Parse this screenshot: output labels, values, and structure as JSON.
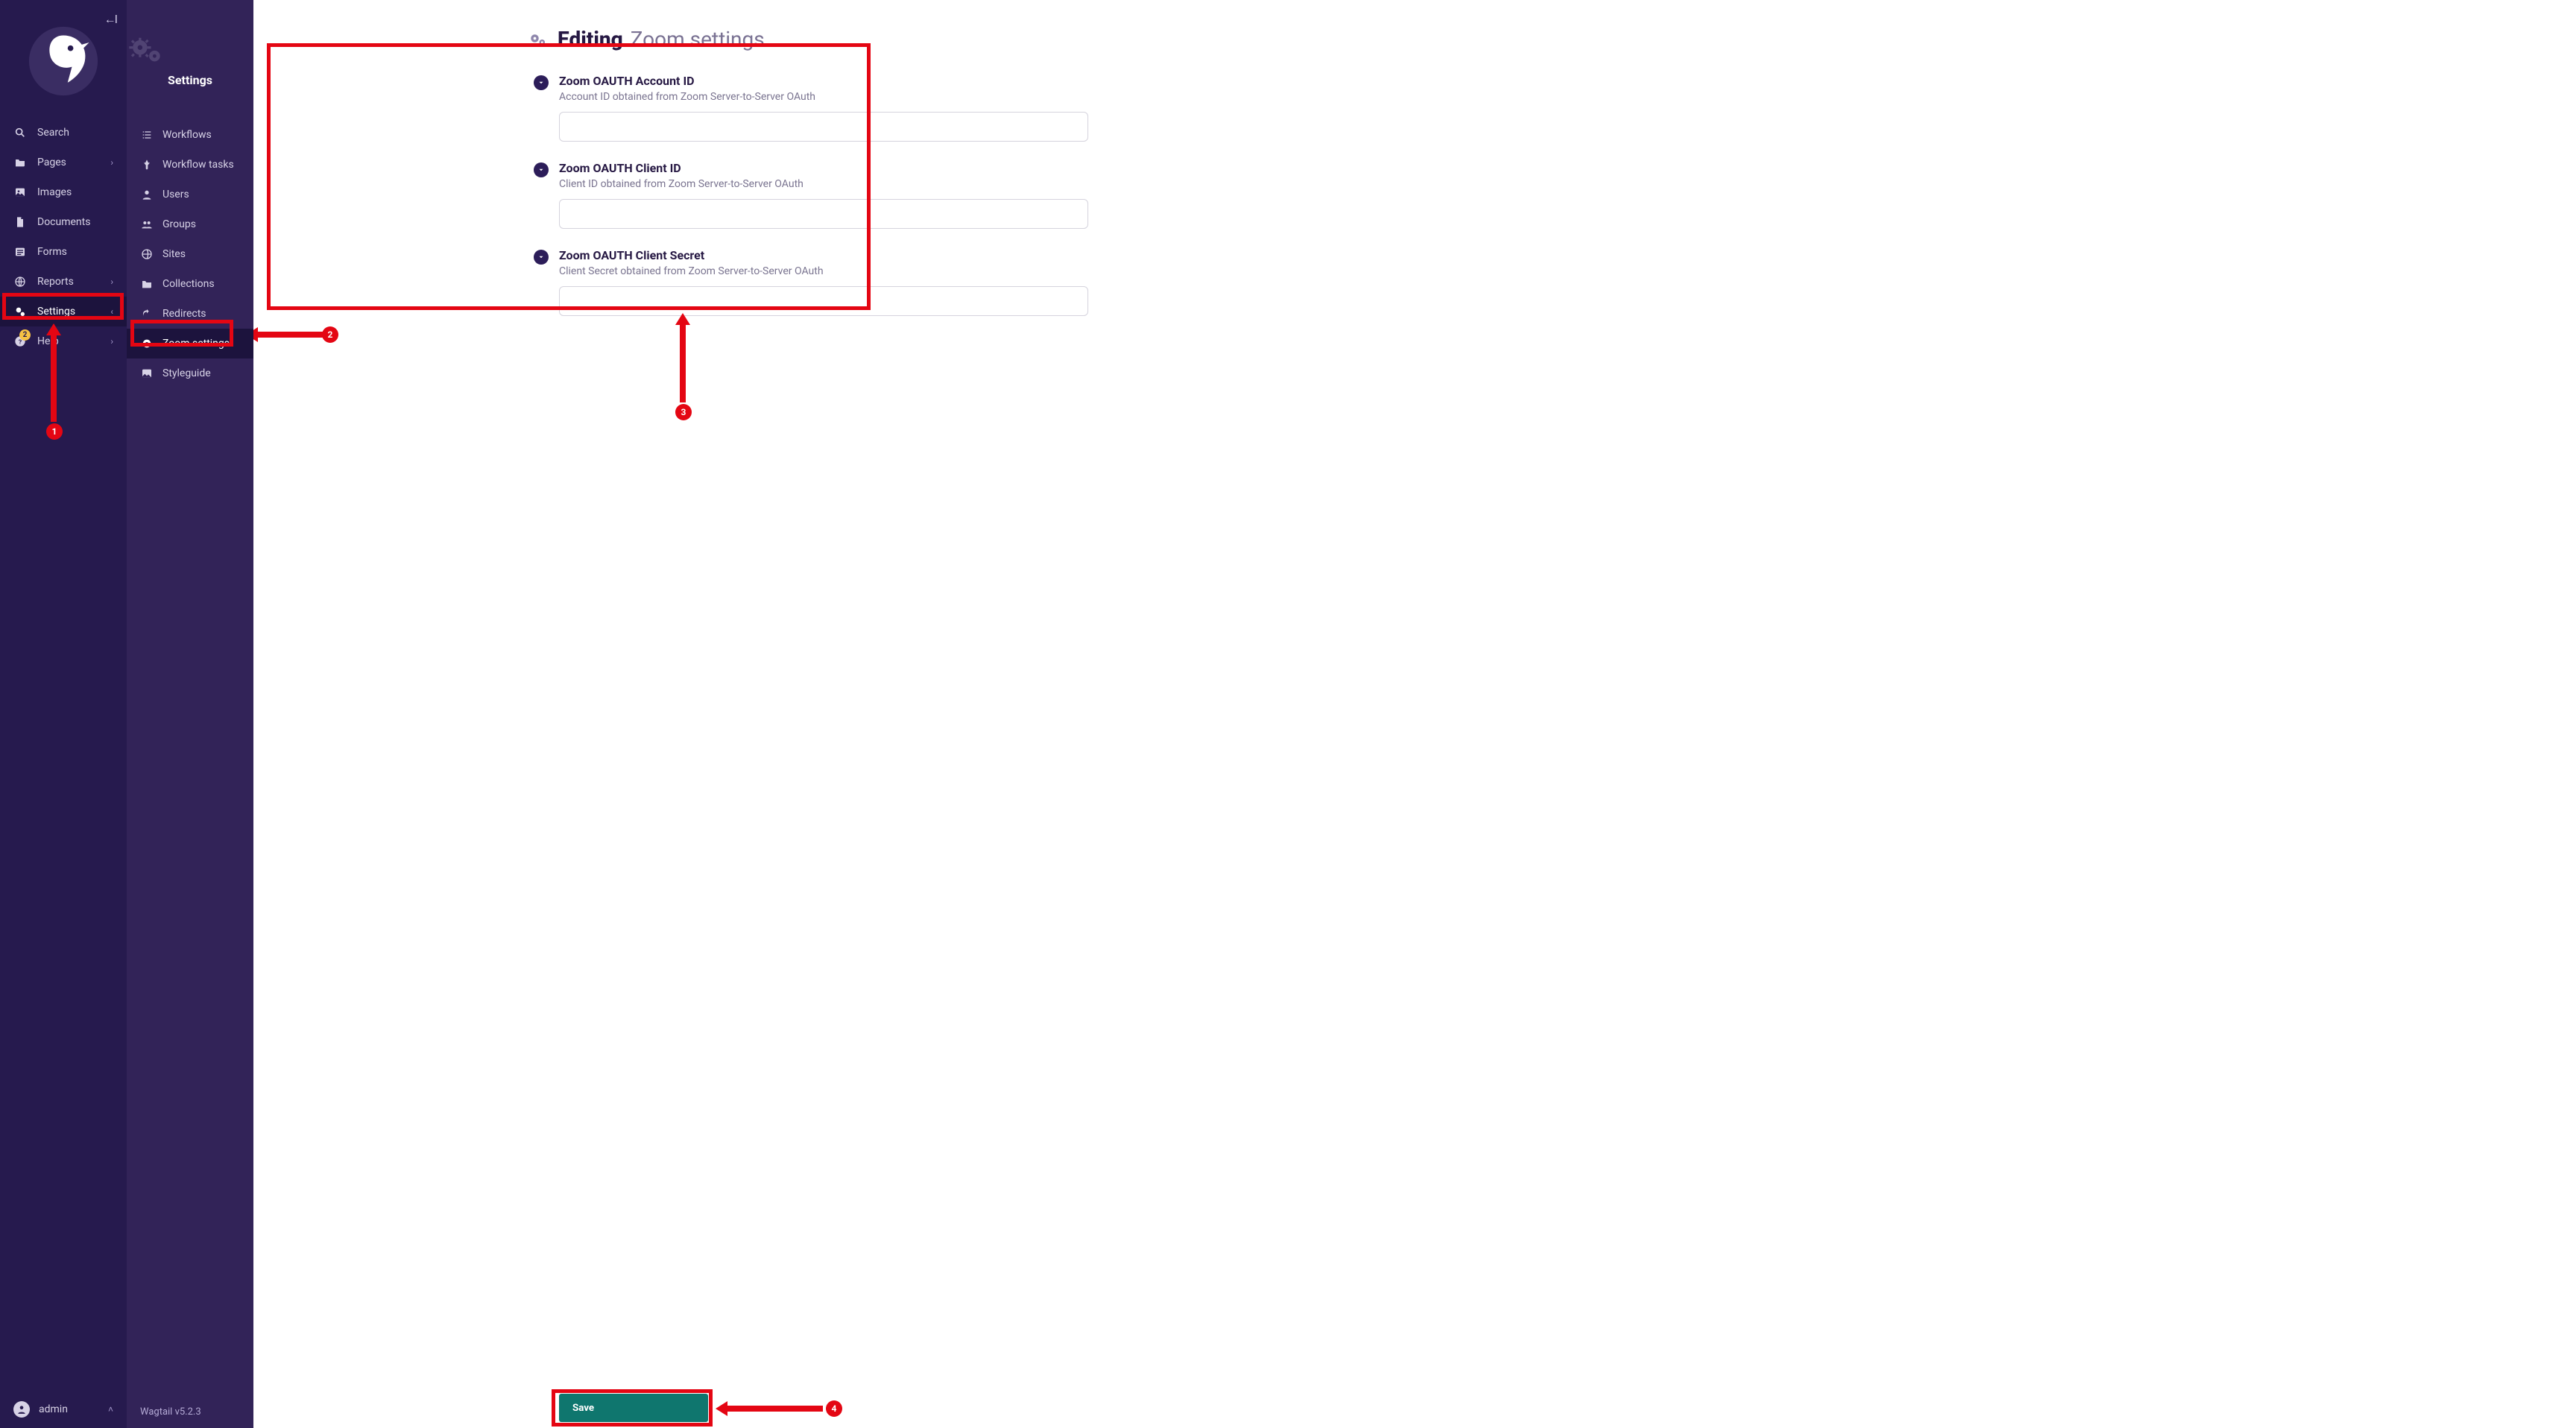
{
  "primary_sidebar": {
    "nav": {
      "search": {
        "label": "Search"
      },
      "pages": {
        "label": "Pages"
      },
      "images": {
        "label": "Images"
      },
      "documents": {
        "label": "Documents"
      },
      "forms": {
        "label": "Forms"
      },
      "reports": {
        "label": "Reports"
      },
      "settings": {
        "label": "Settings"
      },
      "help": {
        "label": "Help",
        "badge": "2"
      }
    },
    "footer": {
      "user_label": "admin"
    }
  },
  "secondary_sidebar": {
    "title": "Settings",
    "items": {
      "workflows": "Workflows",
      "workflow_tasks": "Workflow tasks",
      "users": "Users",
      "groups": "Groups",
      "sites": "Sites",
      "collections": "Collections",
      "redirects": "Redirects",
      "zoom_settings": "Zoom settings",
      "styleguide": "Styleguide"
    },
    "footer": "Wagtail v5.2.3"
  },
  "page": {
    "header": {
      "editing": "Editing",
      "subtitle": "Zoom settings"
    },
    "fields": [
      {
        "label": "Zoom OAUTH Account ID",
        "help": "Account ID obtained from Zoom Server-to-Server OAuth",
        "value": ""
      },
      {
        "label": "Zoom OAUTH Client ID",
        "help": "Client ID obtained from Zoom Server-to-Server OAuth",
        "value": ""
      },
      {
        "label": "Zoom OAUTH Client Secret",
        "help": "Client Secret obtained from Zoom Server-to-Server OAuth",
        "value": ""
      }
    ],
    "save_label": "Save"
  },
  "annotations": {
    "b1": "1",
    "b2": "2",
    "b3": "3",
    "b4": "4"
  }
}
